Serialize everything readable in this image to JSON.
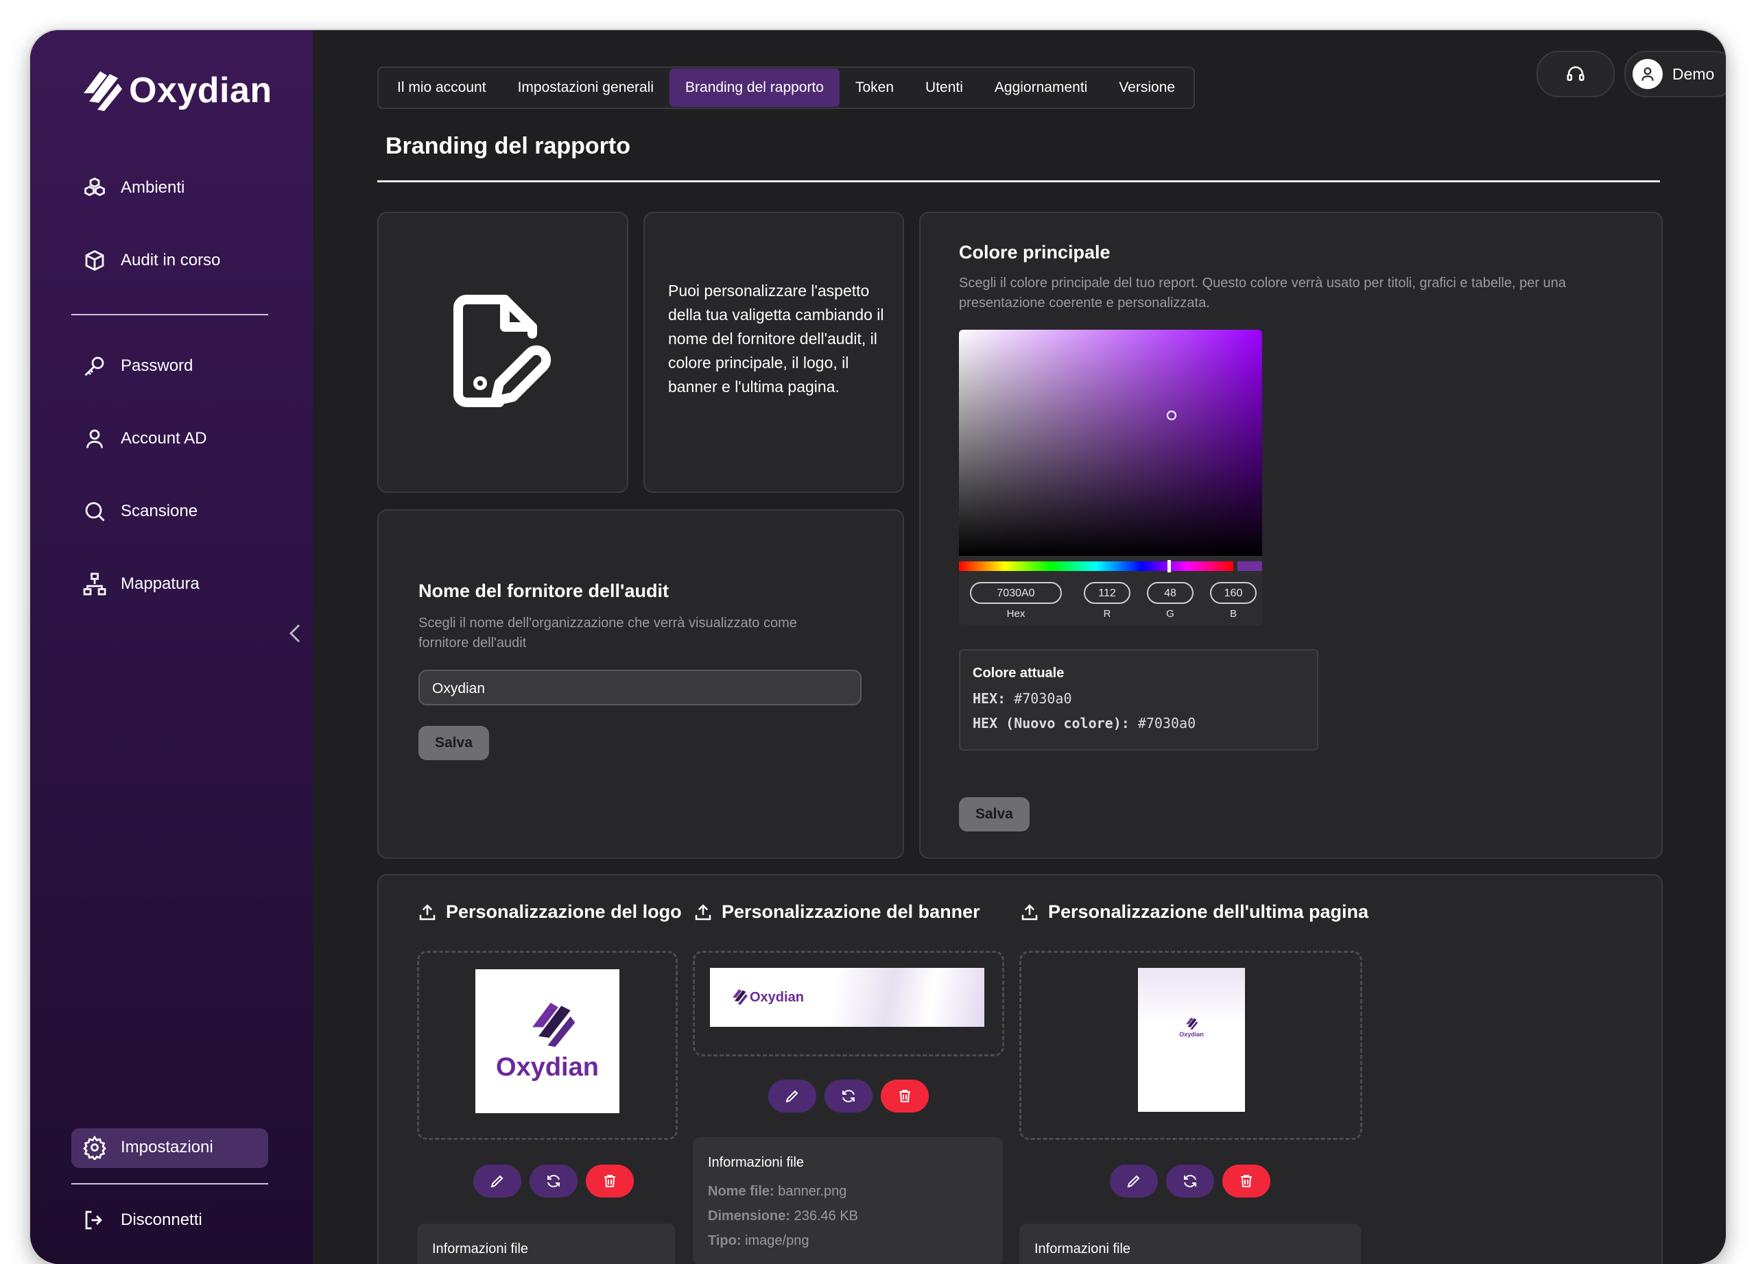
{
  "app": {
    "name": "Oxydian"
  },
  "sidebar": {
    "items": [
      {
        "label": "Ambienti",
        "icon": "cubes-icon"
      },
      {
        "label": "Audit in corso",
        "icon": "box-icon"
      },
      {
        "label": "Password",
        "icon": "key-icon"
      },
      {
        "label": "Account AD",
        "icon": "user-icon"
      },
      {
        "label": "Scansione",
        "icon": "search-icon"
      },
      {
        "label": "Mappatura",
        "icon": "network-icon"
      }
    ],
    "settings_label": "Impostazioni",
    "logout_label": "Disconnetti"
  },
  "header": {
    "user_label": "Demo",
    "support_icon": "headset-icon",
    "user_icon": "user-circle-icon"
  },
  "tabs": [
    {
      "label": "Il mio account",
      "active": false
    },
    {
      "label": "Impostazioni generali",
      "active": false
    },
    {
      "label": "Branding del rapporto",
      "active": true
    },
    {
      "label": "Token",
      "active": false
    },
    {
      "label": "Utenti",
      "active": false
    },
    {
      "label": "Aggiornamenti",
      "active": false
    },
    {
      "label": "Versione",
      "active": false
    }
  ],
  "page": {
    "title": "Branding del rapporto"
  },
  "intro": {
    "text": "Puoi personalizzare l'aspetto della tua valigetta cambiando il nome del fornitore dell'audit, il colore principale, il logo, il banner e l'ultima pagina.",
    "icon": "file-edit-icon"
  },
  "provider": {
    "title": "Nome del fornitore dell'audit",
    "subtitle": "Scegli il nome dell'organizzazione che verrà visualizzato come fornitore dell'audit",
    "value": "Oxydian",
    "save_label": "Salva"
  },
  "color": {
    "title": "Colore principale",
    "subtitle": "Scegli il colore principale del tuo report. Questo colore verrà usato per titoli, grafici e tabelle, per una presentazione coerente e personalizzata.",
    "picker": {
      "hex": "7030A0",
      "r": "112",
      "g": "48",
      "b": "160",
      "hex_label": "Hex",
      "r_label": "R",
      "g_label": "G",
      "b_label": "B"
    },
    "current_title": "Colore attuale",
    "hex_label": "HEX:",
    "hex_value": "#7030a0",
    "new_label": "HEX (Nuovo colore):",
    "new_value": "#7030a0",
    "save_label": "Salva",
    "accent": "#7030a0"
  },
  "uploads": {
    "logo": {
      "title": "Personalizzazione del logo",
      "info_title": "Informazioni file"
    },
    "banner": {
      "title": "Personalizzazione del banner",
      "info_title": "Informazioni file",
      "file_name_label": "Nome file:",
      "file_name": "banner.png",
      "size_label": "Dimensione:",
      "size": "236.46 KB",
      "type_label": "Tipo:",
      "type": "image/png"
    },
    "last_page": {
      "title": "Personalizzazione dell'ultima pagina",
      "info_title": "Informazioni file"
    },
    "icons": {
      "upload": "upload-icon",
      "edit": "pencil-icon",
      "replace": "refresh-icon",
      "delete": "trash-icon"
    }
  },
  "preview": {
    "logo_word": "Oxydian",
    "banner_word": "Oxydian",
    "lastpage_word": "Oxydian"
  },
  "colors": {
    "sidebar": "#3a1854",
    "active_tab": "#4e2a72",
    "danger": "#f2283a",
    "background": "#1f1f21"
  }
}
